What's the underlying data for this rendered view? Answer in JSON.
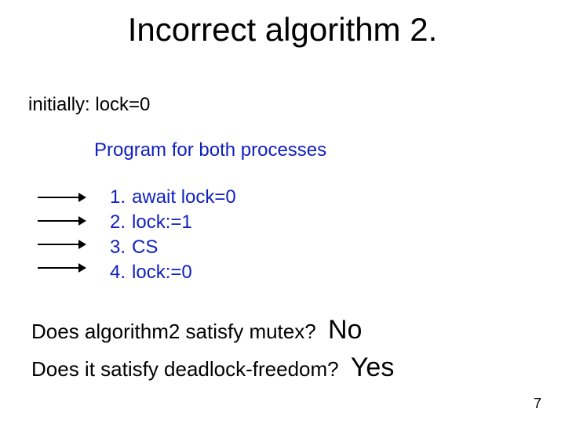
{
  "title": "Incorrect algorithm 2.",
  "initially": "initially: lock=0",
  "program_label": "Program for both processes",
  "steps": [
    {
      "num": "1.",
      "code": "await  lock=0"
    },
    {
      "num": "2.",
      "code": "lock:=1"
    },
    {
      "num": "3.",
      "code": "CS"
    },
    {
      "num": "4.",
      "code": "lock:=0"
    }
  ],
  "q1_text": "Does algorithm2 satisfy mutex?",
  "q1_answer": "No",
  "q2_text": "Does it satisfy deadlock-freedom?",
  "q2_answer": "Yes",
  "page_number": "7"
}
